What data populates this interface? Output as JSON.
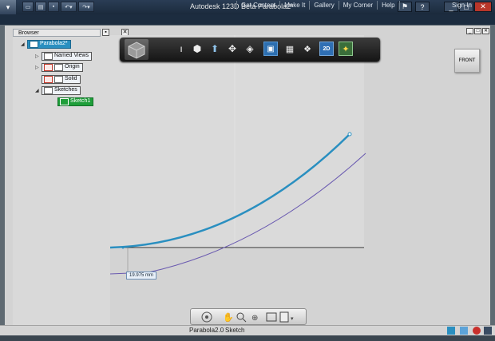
{
  "titlebar": {
    "title": "Autodesk 123D Beta   Parabola2*",
    "controls": [
      "minimize",
      "maximize",
      "close"
    ]
  },
  "menubar": {
    "items": [
      "Get Content",
      "Make It",
      "Gallery",
      "My Corner",
      "Help"
    ],
    "more": "▸",
    "signin": "Sign In"
  },
  "browser": {
    "title": "Browser",
    "root": "Parabola2*",
    "nodes": [
      "Named Views",
      "Origin",
      "Solid",
      "Sketches"
    ],
    "sketch": "Sketch1"
  },
  "viewcube": {
    "label": "FRONT"
  },
  "dimension": {
    "value": "19.975 mm"
  },
  "status": {
    "document": "Parabola2.0",
    "mode": "Sketch"
  },
  "colors": {
    "accent": "#2a8fc0",
    "selection": "#1f9e3a",
    "curve_secondary": "#6a5ab0"
  }
}
